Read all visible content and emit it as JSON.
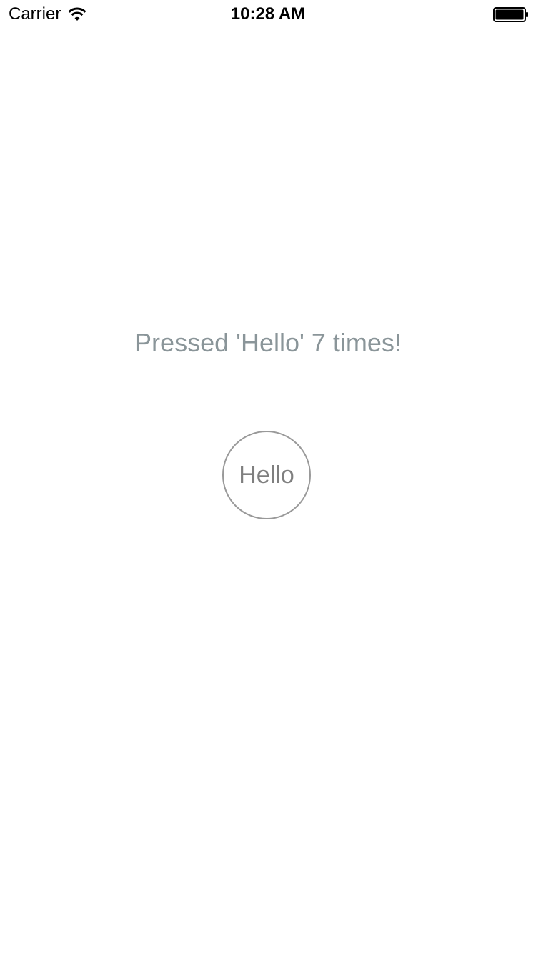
{
  "status_bar": {
    "carrier": "Carrier",
    "time": "10:28 AM",
    "icons": [
      "wifi-icon",
      "battery-icon"
    ]
  },
  "main": {
    "counter_text": "Pressed 'Hello' 7 times!",
    "hello_button_label": "Hello"
  },
  "colors": {
    "counter_text": "#8a9599",
    "button_border": "#999999",
    "button_text": "#7f7f7f",
    "background": "#ffffff"
  }
}
